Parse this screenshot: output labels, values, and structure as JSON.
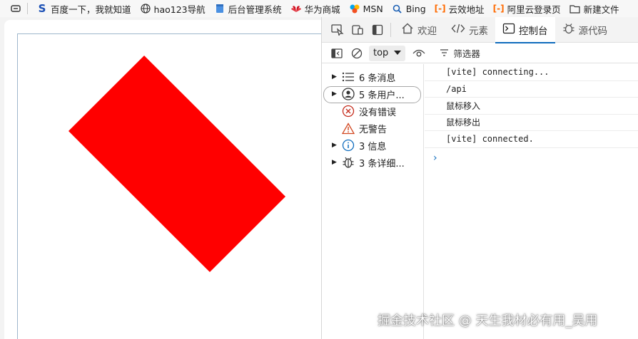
{
  "bookmarks": [
    {
      "label": "",
      "icon": "reading-list-icon"
    },
    {
      "label": "百度一下，我就知道",
      "icon": "sogou-icon"
    },
    {
      "label": "hao123导航",
      "icon": "globe-icon"
    },
    {
      "label": "后台管理系统",
      "icon": "page-icon"
    },
    {
      "label": "华为商城",
      "icon": "huawei-icon"
    },
    {
      "label": "MSN",
      "icon": "msn-icon"
    },
    {
      "label": "Bing",
      "icon": "search-icon"
    },
    {
      "label": "云效地址",
      "icon": "aliyun-icon"
    },
    {
      "label": "阿里云登录页",
      "icon": "aliyun-icon"
    },
    {
      "label": "新建文件",
      "icon": "folder-icon"
    }
  ],
  "devtools": {
    "tabs": [
      {
        "label": "欢迎",
        "icon": "home-icon"
      },
      {
        "label": "元素",
        "icon": "code-icon"
      },
      {
        "label": "控制台",
        "icon": "console-icon",
        "active": true
      },
      {
        "label": "源代码",
        "icon": "bug-icon"
      }
    ],
    "toolbar": {
      "context": "top",
      "filter_label": "筛选器"
    },
    "sidebar": [
      {
        "label": "6 条消息",
        "icon": "list-icon",
        "expandable": true
      },
      {
        "label": "5 条用户...",
        "icon": "user-icon",
        "expandable": true,
        "selected": true
      },
      {
        "label": "没有错误",
        "icon": "error-icon",
        "expandable": false
      },
      {
        "label": "无警告",
        "icon": "warning-icon",
        "expandable": false
      },
      {
        "label": "3 信息",
        "icon": "info-icon",
        "expandable": true
      },
      {
        "label": "3 条详细...",
        "icon": "verbose-bug-icon",
        "expandable": true
      }
    ],
    "console_lines": [
      "[vite] connecting...",
      "/api",
      "鼠标移入",
      "鼠标移出",
      "[vite] connected."
    ],
    "prompt": "›"
  },
  "page": {
    "shape_color": "#ff0000"
  },
  "watermark": "掘金技术社区 @ 天生我材必有用_吴用"
}
